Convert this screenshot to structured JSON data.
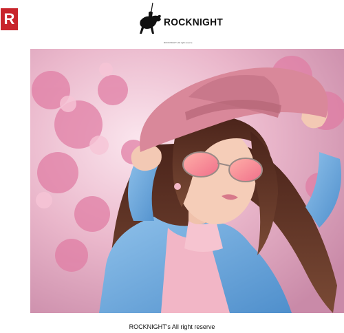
{
  "badge": {
    "letter": "R",
    "color": "#c8242b"
  },
  "logo": {
    "brand_name": "ROCKNIGHT",
    "subtitle": "ROCKNIGHT's All right reserve",
    "icon": "knight-on-horse-icon"
  },
  "photo": {
    "subject": "woman-in-pink-hat-and-aviator-sunglasses",
    "palette": {
      "blossom": "#e59ab8",
      "hat": "#d98a98",
      "jacket": "#6aa5d9",
      "hair": "#5a2e22",
      "skin": "#f2c9b5"
    }
  },
  "footer": {
    "caption": "ROCKNIGHT's All right reserve"
  }
}
